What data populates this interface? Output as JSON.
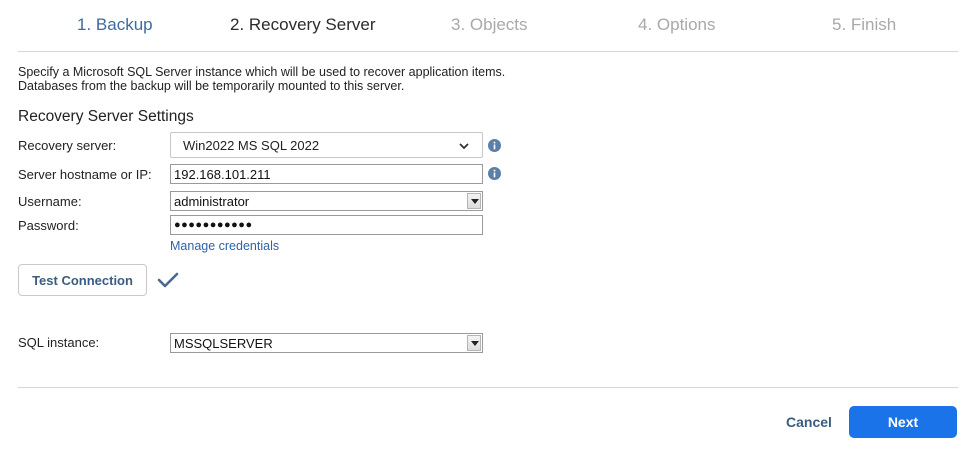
{
  "steps": [
    {
      "label": "1. Backup",
      "state": "done"
    },
    {
      "label": "2. Recovery Server",
      "state": "current"
    },
    {
      "label": "3. Objects",
      "state": "future"
    },
    {
      "label": "4. Options",
      "state": "future"
    },
    {
      "label": "5. Finish",
      "state": "future"
    }
  ],
  "description": {
    "line1": "Specify a Microsoft SQL Server instance which will be used to recover application items.",
    "line2": "Databases from the backup will be temporarily mounted to this server."
  },
  "section_title": "Recovery Server Settings",
  "form": {
    "recovery_server": {
      "label": "Recovery server:",
      "value": "Win2022 MS SQL 2022"
    },
    "hostname": {
      "label": "Server hostname or IP:",
      "value": "192.168.101.211"
    },
    "username": {
      "label": "Username:",
      "value": "administrator"
    },
    "password": {
      "label": "Password:",
      "value": "●●●●●●●●●●●"
    },
    "manage_credentials": "Manage credentials",
    "sql_instance": {
      "label": "SQL instance:",
      "value": "MSSQLSERVER"
    }
  },
  "test_connection": {
    "label": "Test Connection",
    "status_icon": "checkmark-icon"
  },
  "footer": {
    "cancel_label": "Cancel",
    "next_label": "Next"
  },
  "colors": {
    "step_done": "#3d6b9e",
    "step_current": "#2b2b2b",
    "step_future": "#a9a9a9",
    "link": "#2f62a8",
    "primary_button": "#1a73e8",
    "info_icon": "#5b7fa8",
    "check_icon": "#4a6a8c"
  }
}
